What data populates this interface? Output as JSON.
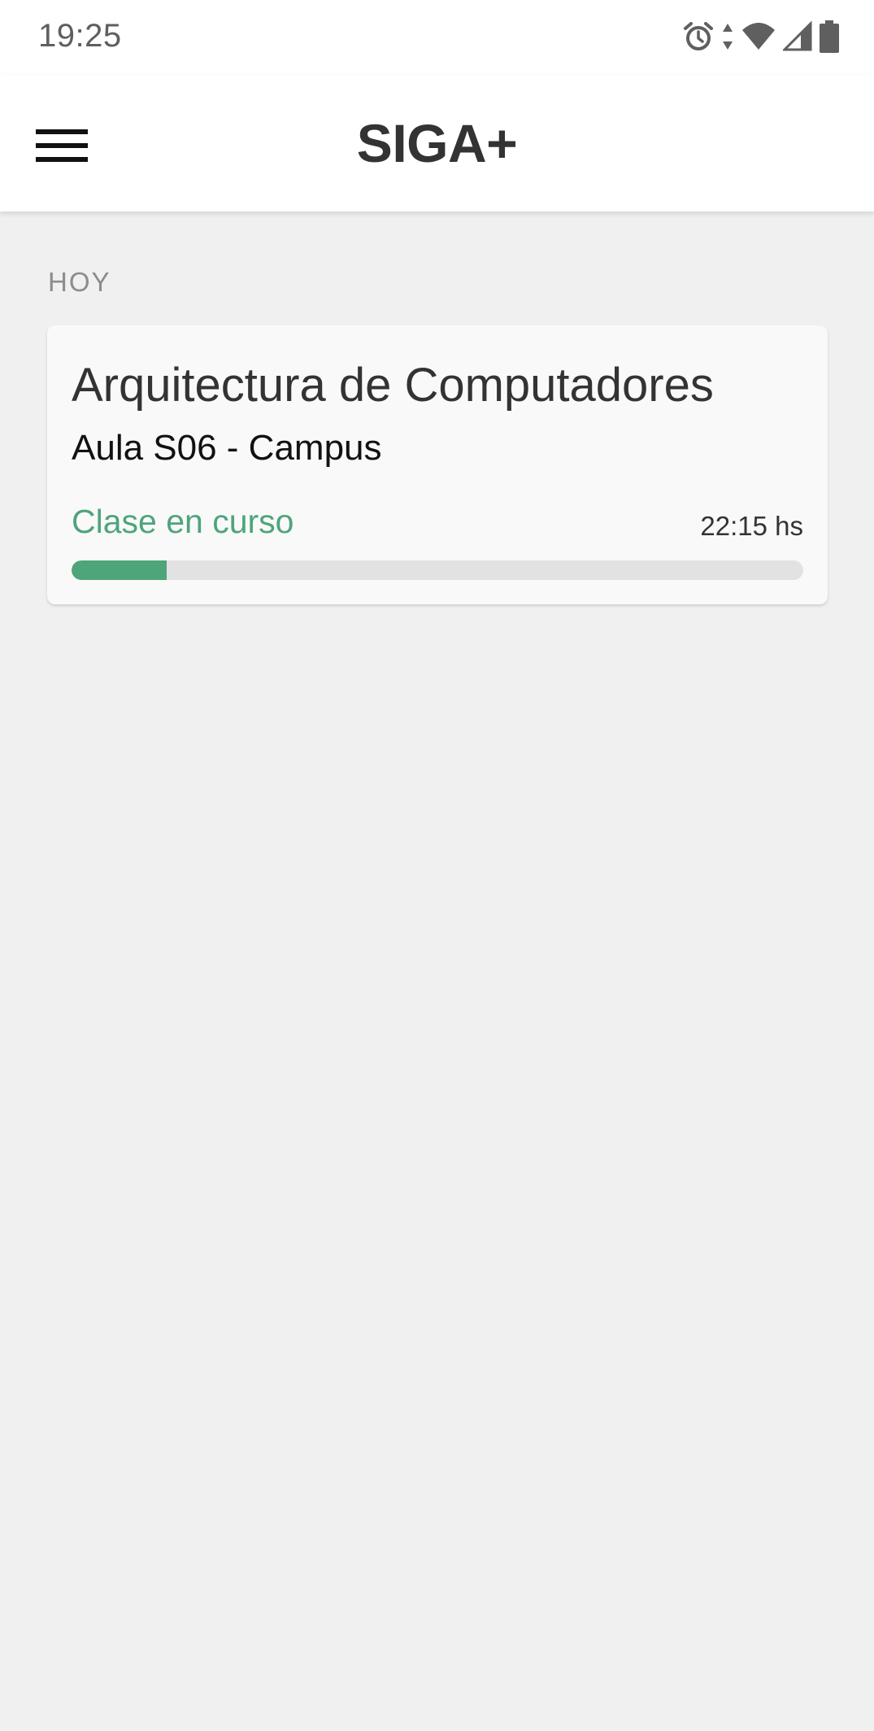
{
  "status_bar": {
    "time": "19:25",
    "icons": [
      "alarm-icon",
      "data-arrows-icon",
      "wifi-icon",
      "cell-signal-icon",
      "battery-icon"
    ]
  },
  "app_bar": {
    "title": "SIGA+",
    "menu_icon": "hamburger-menu-icon"
  },
  "section": {
    "label": "HOY"
  },
  "class_card": {
    "name": "Arquitectura de Computadores",
    "room": "Aula S06 - Campus",
    "status": "Clase en curso",
    "end_time": "22:15 hs",
    "progress": 0.13
  },
  "colors": {
    "accent": "#4ea57a",
    "background": "#f0f0f0",
    "card": "#faf9fa",
    "title_text": "#333333",
    "track": "#e3e2e3"
  }
}
